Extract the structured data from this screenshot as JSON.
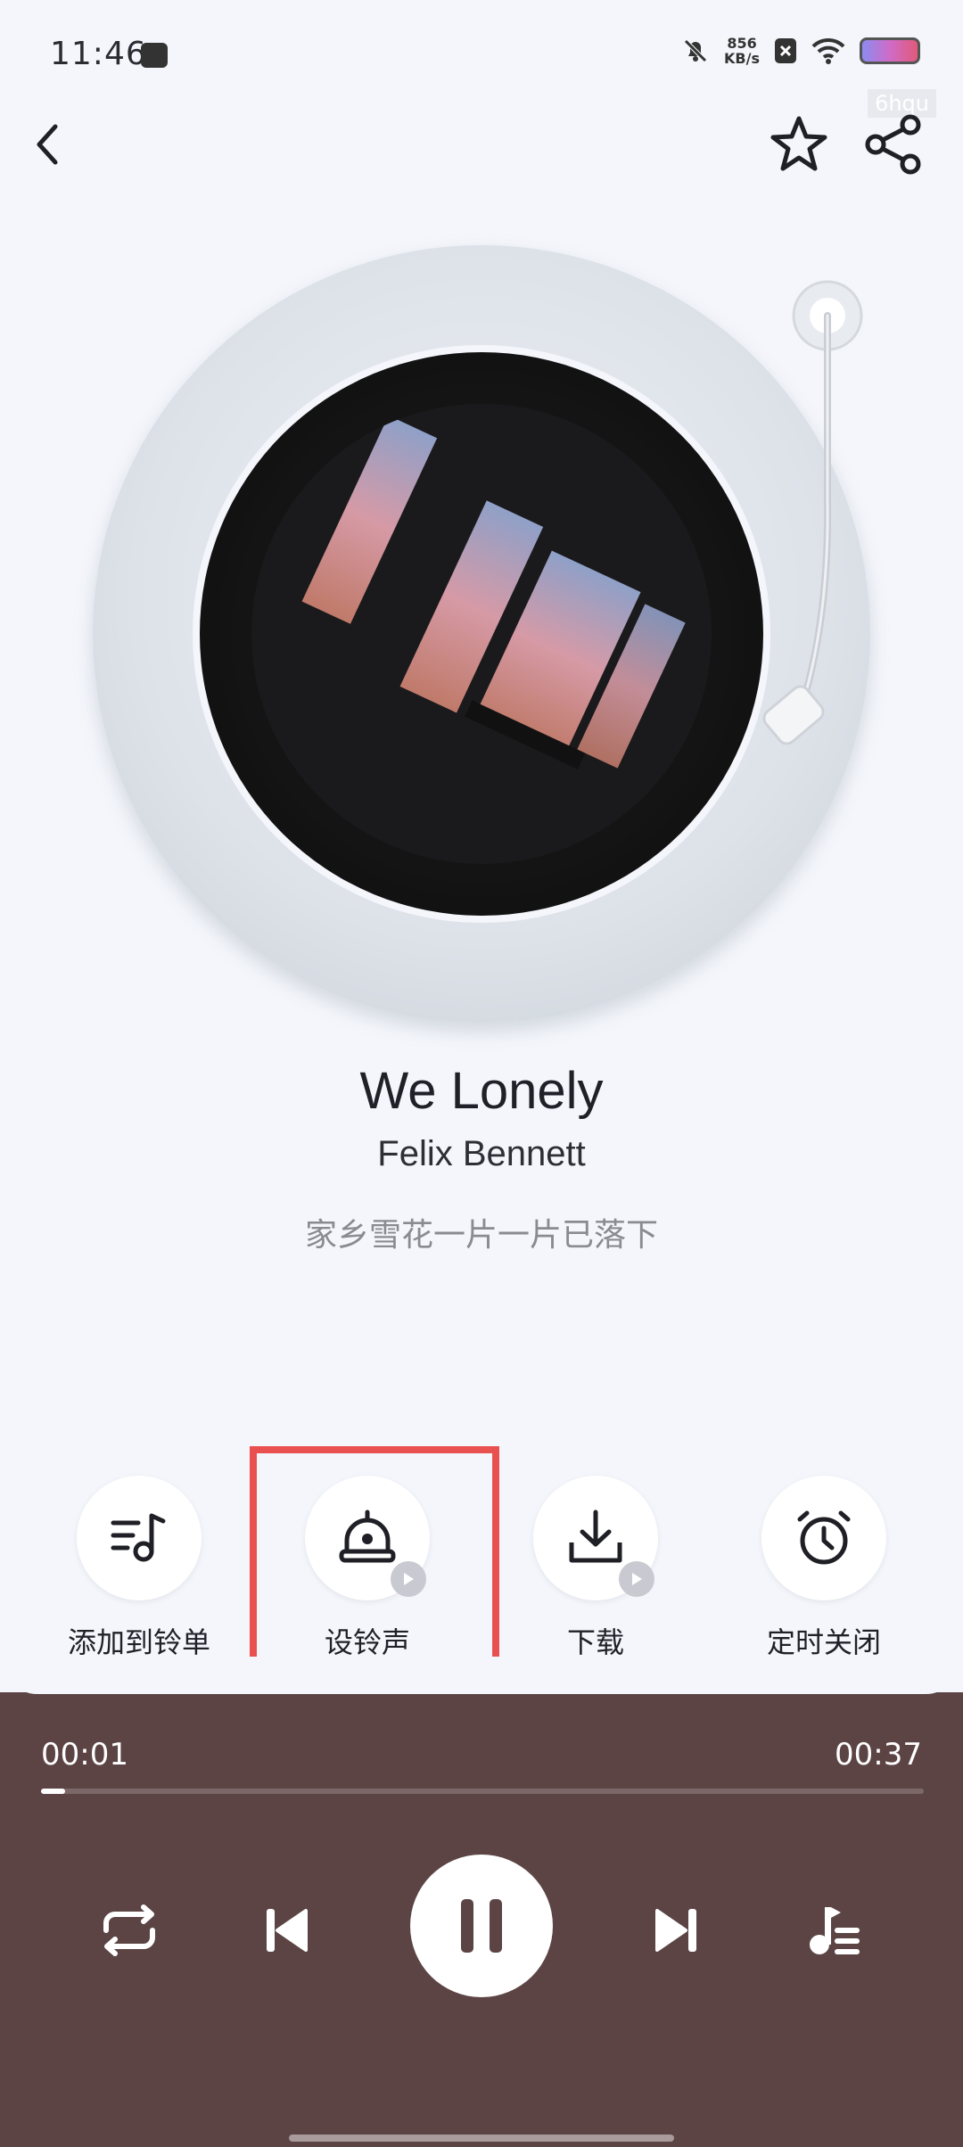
{
  "status_bar": {
    "time": "11:46",
    "net_speed_value": "856",
    "net_speed_unit": "KB/s",
    "watermark": "6hqu"
  },
  "song": {
    "title": "We Lonely",
    "artist": "Felix Bennett",
    "lyric": "家乡雪花一片一片已落下"
  },
  "actions": [
    {
      "label": "添加到铃单",
      "icon": "add-to-playlist-icon"
    },
    {
      "label": "设铃声",
      "icon": "bell-icon"
    },
    {
      "label": "下载",
      "icon": "download-icon"
    },
    {
      "label": "定时关闭",
      "icon": "alarm-clock-icon"
    }
  ],
  "player": {
    "current_time": "00:01",
    "total_time": "00:37",
    "progress_fraction": 0.027
  },
  "colors": {
    "player_bg": "#5c4445",
    "highlight": "#e8514f",
    "page_bg": "#f4f6fb"
  }
}
